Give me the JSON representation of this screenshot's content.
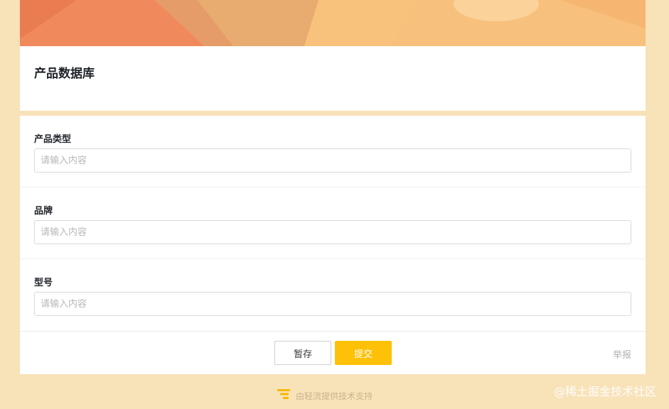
{
  "form": {
    "title": "产品数据库",
    "fields": [
      {
        "label": "产品类型",
        "placeholder": "请输入内容",
        "value": ""
      },
      {
        "label": "品牌",
        "placeholder": "请输入内容",
        "value": ""
      },
      {
        "label": "型号",
        "placeholder": "请输入内容",
        "value": ""
      }
    ],
    "save_label": "暂存",
    "submit_label": "提交",
    "report_label": "举报"
  },
  "footer": {
    "powered_by": "由轻流提供技术支持"
  },
  "watermark": "@稀土掘金技术社区",
  "colors": {
    "background": "#f8e2b8",
    "accent": "#ffc107",
    "banner": "#f9c07a"
  },
  "icons": {
    "brand_logo": "qingflow-logo-icon"
  }
}
